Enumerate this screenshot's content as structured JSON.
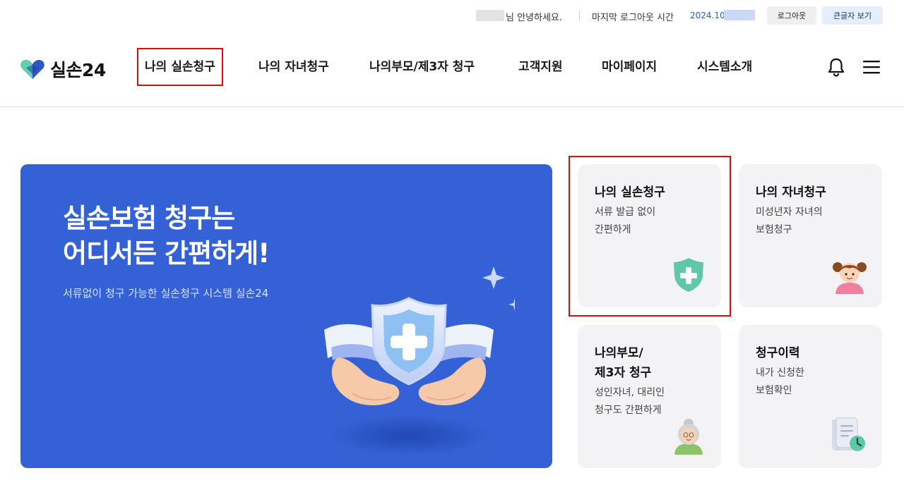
{
  "topbar": {
    "greeting": "님 안녕하세요.",
    "last_logout_label": "마지막 로그아웃 시간",
    "last_logout_value": "2024.10.",
    "logout_button": "로그아웃",
    "big_text_button": "큰글자 보기"
  },
  "header": {
    "logo_text": "실손24",
    "nav": [
      {
        "label": "나의 실손청구"
      },
      {
        "label": "나의 자녀청구"
      },
      {
        "label": "나의부모/제3자 청구"
      },
      {
        "label": "고객지원"
      },
      {
        "label": "마이페이지"
      },
      {
        "label": "시스템소개"
      }
    ],
    "icons": [
      "bell-icon",
      "menu-icon"
    ]
  },
  "banner": {
    "title_line1": "실손보험 청구는",
    "title_line2": "어디서든 간편하게!",
    "subtitle": "서류없이 청구 가능한 실손청구 시스템 실손24"
  },
  "cards": [
    {
      "title": "나의 실손청구",
      "desc_line1": "서류 발급 없이",
      "desc_line2": "간편하게",
      "icon": "shield-plus-icon"
    },
    {
      "title": "나의 자녀청구",
      "desc_line1": "미성년자 자녀의",
      "desc_line2": "보험청구",
      "icon": "child-icon"
    },
    {
      "title_line1": "나의부모/",
      "title_line2": "제3자 청구",
      "desc_line1": "성인자녀, 대리인",
      "desc_line2": "청구도 간편하게",
      "icon": "grandmother-icon"
    },
    {
      "title": "청구이력",
      "desc_line1": "내가 신청한",
      "desc_line2": "보험확인",
      "icon": "document-clock-icon"
    }
  ],
  "colors": {
    "brand_blue": "#3462d6",
    "mint": "#5fc8a7",
    "highlight_red": "#d40f0f",
    "card_bg": "#f3f3f6"
  }
}
